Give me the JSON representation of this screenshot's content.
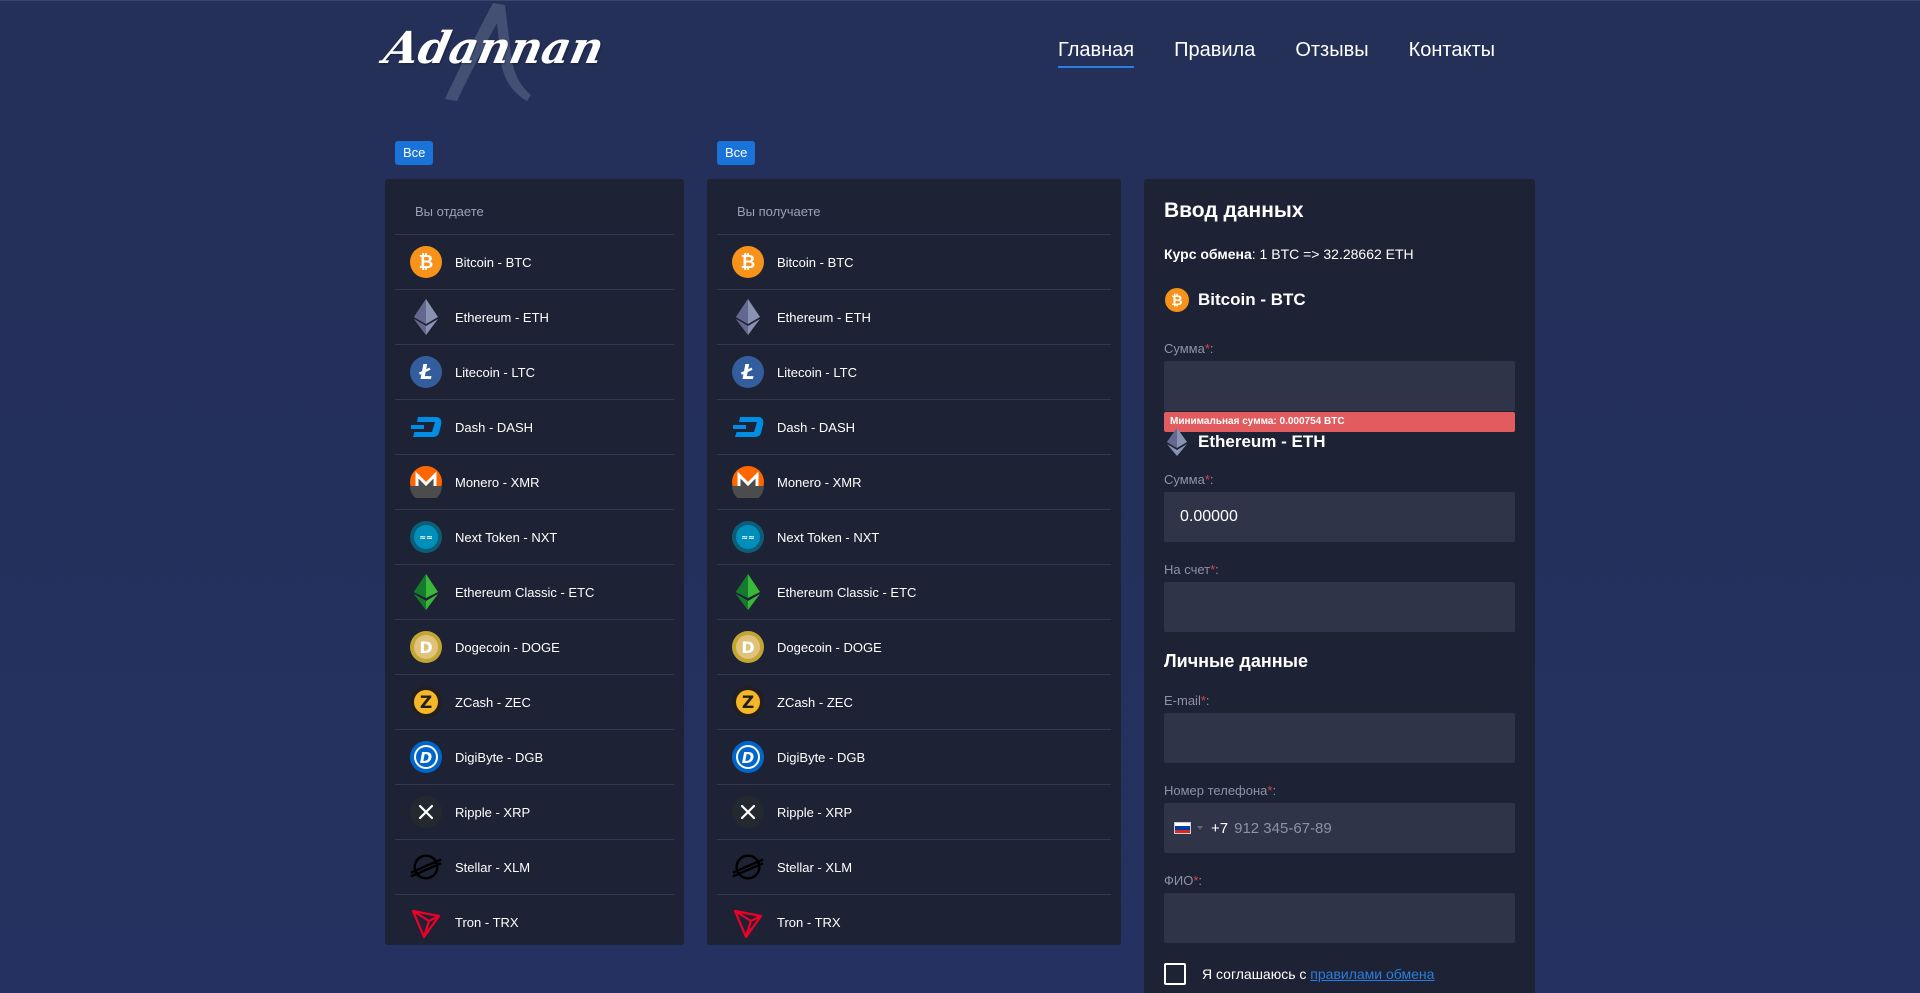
{
  "logo": {
    "text": "Adannan"
  },
  "nav": [
    {
      "label": "Главная",
      "active": true
    },
    {
      "label": "Правила",
      "active": false
    },
    {
      "label": "Отзывы",
      "active": false
    },
    {
      "label": "Контакты",
      "active": false
    }
  ],
  "give": {
    "filter_label": "Все",
    "header": "Вы отдаете"
  },
  "receive": {
    "filter_label": "Все",
    "header": "Вы получаете"
  },
  "coins": [
    {
      "label": "Bitcoin - BTC",
      "icon": "bitcoin-icon",
      "color": "#f7931a"
    },
    {
      "label": "Ethereum - ETH",
      "icon": "ethereum-icon",
      "color": "#8a92b2"
    },
    {
      "label": "Litecoin - LTC",
      "icon": "litecoin-icon",
      "color": "#345d9d"
    },
    {
      "label": "Dash - DASH",
      "icon": "dash-icon",
      "color": "#008de4"
    },
    {
      "label": "Monero - XMR",
      "icon": "monero-icon",
      "color": "#ff6600"
    },
    {
      "label": "Next Token - NXT",
      "icon": "nxt-icon",
      "color": "#008fbb"
    },
    {
      "label": "Ethereum Classic - ETC",
      "icon": "ethereum-classic-icon",
      "color": "#3ab83a"
    },
    {
      "label": "Dogecoin - DOGE",
      "icon": "dogecoin-icon",
      "color": "#c2a633"
    },
    {
      "label": "ZCash - ZEC",
      "icon": "zcash-icon",
      "color": "#f4b728"
    },
    {
      "label": "DigiByte - DGB",
      "icon": "digibyte-icon",
      "color": "#0066cc"
    },
    {
      "label": "Ripple - XRP",
      "icon": "ripple-icon",
      "color": "#23292f"
    },
    {
      "label": "Stellar - XLM",
      "icon": "stellar-icon",
      "color": "#000000"
    },
    {
      "label": "Tron - TRX",
      "icon": "tron-icon",
      "color": "#ef0027"
    }
  ],
  "form": {
    "title": "Ввод данных",
    "rate_label": "Курс обмена",
    "rate_value": ": 1 BTC => 32.28662 ETH",
    "give_coin": "Bitcoin - BTC",
    "give_amount_label": "Сумма",
    "give_amount_value": "",
    "min_error": "Минимальная сумма: 0.000754 BTC",
    "get_coin": "Ethereum - ETH",
    "get_amount_label": "Сумма",
    "get_amount_value": "0.00000",
    "account_label": "На счет",
    "account_value": "",
    "personal_title": "Личные данные",
    "email_label": "E-mail",
    "email_value": "",
    "phone_label": "Номер телефона",
    "phone_code": "+7",
    "phone_placeholder": "912 345-67-89",
    "fio_label": "ФИО",
    "fio_value": "",
    "agree_text": "Я соглашаюсь с ",
    "agree_link": "правилами обмена",
    "required_mark": "*",
    "colon": ":"
  }
}
